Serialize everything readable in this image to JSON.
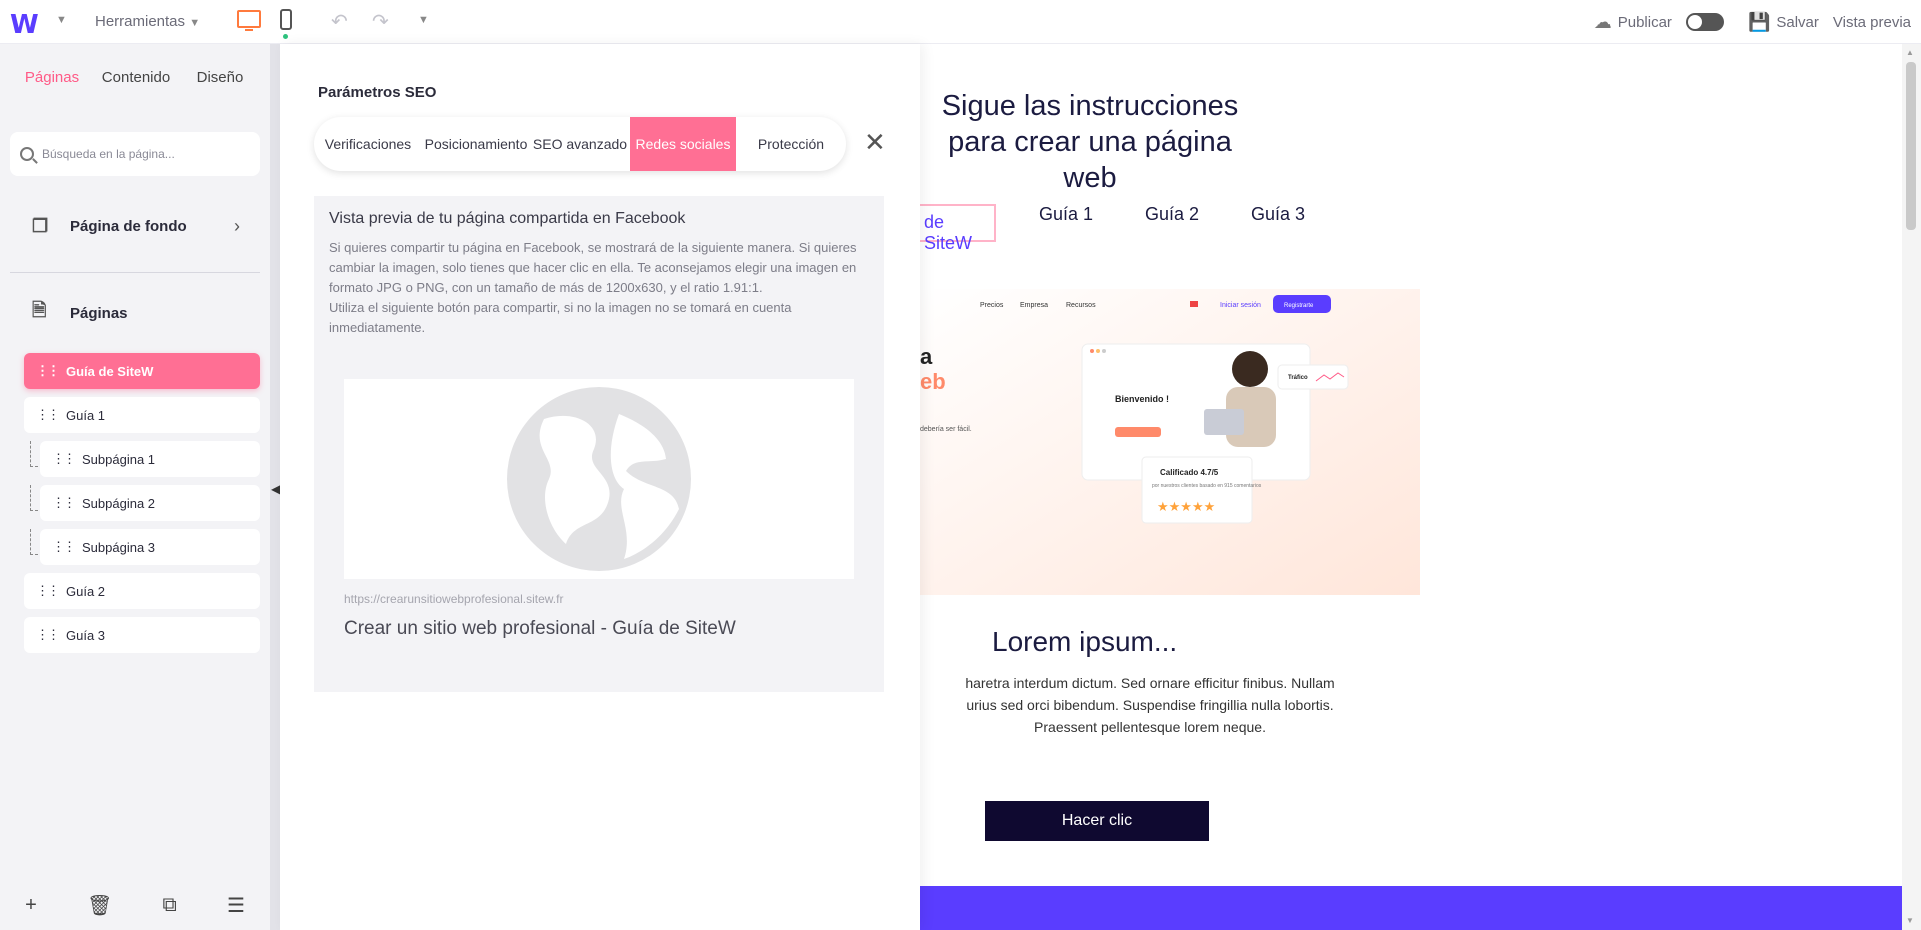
{
  "topbar": {
    "brand": "W",
    "tools_label": "Herramientas",
    "publish_label": "Publicar",
    "save_label": "Salvar",
    "preview_label": "Vista previa"
  },
  "sidebar": {
    "tabs": [
      {
        "label": "Páginas",
        "active": true
      },
      {
        "label": "Contenido",
        "active": false
      },
      {
        "label": "Diseño",
        "active": false
      }
    ],
    "search_placeholder": "Búsqueda en la página...",
    "background_page_label": "Página de fondo",
    "pages_label": "Páginas",
    "pages": [
      {
        "label": "Guía de SiteW",
        "active": true,
        "level": 0
      },
      {
        "label": "Guía 1",
        "active": false,
        "level": 0
      },
      {
        "label": "Subpágina 1",
        "active": false,
        "level": 1
      },
      {
        "label": "Subpágina 2",
        "active": false,
        "level": 1
      },
      {
        "label": "Subpágina 3",
        "active": false,
        "level": 1
      },
      {
        "label": "Guía 2",
        "active": false,
        "level": 0
      },
      {
        "label": "Guía 3",
        "active": false,
        "level": 0
      }
    ]
  },
  "seo": {
    "title": "Parámetros SEO",
    "tabs": [
      {
        "label": "Verificaciones",
        "active": false
      },
      {
        "label": "Posicionamiento",
        "active": false
      },
      {
        "label": "SEO avanzado",
        "active": false
      },
      {
        "label": "Redes sociales",
        "active": true
      },
      {
        "label": "Protección",
        "active": false
      }
    ],
    "facebook_preview": {
      "heading": "Vista previa de tu página compartida en Facebook",
      "desc1": "Si quieres compartir tu página en Facebook, se mostrará de la siguiente manera. Si quieres cambiar la imagen, solo tienes que hacer clic en ella. Te aconsejamos elegir una imagen en formato JPG o PNG, con un tamaño de más de 1200x630, y el ratio 1.91:1.",
      "desc2": "Utiliza el siguiente botón para compartir, si no la imagen no se tomará en cuenta inmediatamente.",
      "url": "https://crearunsitiowebprofesional.sitew.fr",
      "page_title": "Crear un sitio web profesional - Guía de SiteW"
    }
  },
  "canvas": {
    "hero_line1": "Sigue las instrucciones",
    "hero_line2": "para crear una página web",
    "nav_items": [
      "de SiteW",
      "Guía 1",
      "Guía 2",
      "Guía 3"
    ],
    "mock": {
      "nav": [
        "Precios",
        "Empresa",
        "Recursos"
      ],
      "login": "Iniciar sesión",
      "register": "Registrarte",
      "welcome": "Bienvenido !",
      "traffic": "Tráfico",
      "rating": "Calificado 4.7/5",
      "rating_sub": "por nuestros clientes basado en 915 comentarios",
      "hint": "debería ser fácil."
    },
    "section_title": "Lorem ipsum...",
    "section_body_l1": "haretra interdum dictum. Sed ornare efficitur finibus. Nullam",
    "section_body_l2": "urius sed orci bibendum. Suspendise fringillia nulla lobortis.",
    "section_body_l3": "Praessent pellentesque lorem neque.",
    "cta_label": "Hacer clic"
  },
  "colors": {
    "accent_pink": "#ff6f94",
    "brand_purple": "#5a3dff",
    "cta_dark": "#0f0930"
  }
}
